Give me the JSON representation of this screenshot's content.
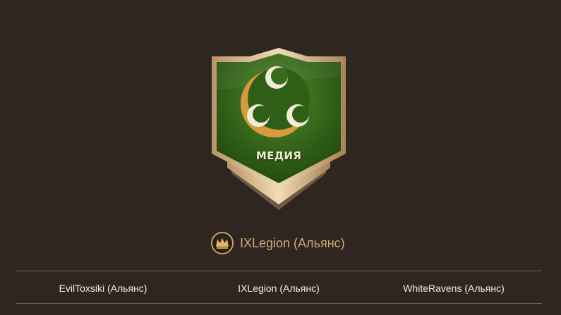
{
  "faction": {
    "name": "МЕДИЯ",
    "emblem_icon": "three-crescents-icon",
    "banner_color": "#3c6a1e",
    "trim_color": "#d8b98a",
    "crescent_color": "#d89a3e"
  },
  "owner": {
    "badge_icon": "crown-badge-icon",
    "name": "IXLegion (Альянс)"
  },
  "alliances": [
    {
      "name": "EvilToxsiki (Альянс)"
    },
    {
      "name": "IXLegion (Альянс)"
    },
    {
      "name": "WhiteRavens (Альянс)"
    }
  ]
}
